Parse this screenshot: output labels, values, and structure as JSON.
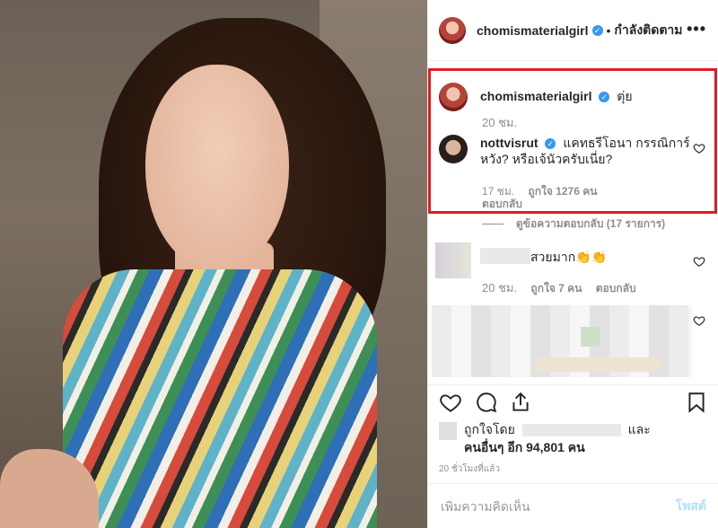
{
  "post": {
    "author": "chomismaterialgirl",
    "follow_status": "กำลังติดตาม",
    "separator": "•",
    "more": "•••"
  },
  "caption": {
    "username": "chomismaterialgirl",
    "text": "ตุ่ย",
    "time": "20 ชม."
  },
  "comments": [
    {
      "username": "nottvisrut",
      "text_line1": "แคทธรีโอนา กรรณิการ์",
      "text_line2": "หวัง? หรือเจ้นัวครับเนี่ย?",
      "time": "17 ชม.",
      "likes": "ถูกใจ 1276 คน",
      "reply": "ตอบกลับ",
      "view_replies": "ดูข้อความตอบกลับ (17 รายการ)"
    },
    {
      "text": "สวยมาก👏👏",
      "time": "20 ชม.",
      "likes": "ถูกใจ 7 คน",
      "reply": "ตอบกลับ"
    }
  ],
  "likes_section": {
    "liked_by": "ถูกใจโดย",
    "and": "และ",
    "others": "คนอื่นๆ อีก 94,801 คน",
    "time_ago": "20 ชั่วโมงที่แล้ว"
  },
  "add_comment": {
    "placeholder": "เพิ่มความคิดเห็น",
    "post_label": "โพสต์"
  },
  "colors": {
    "highlight_border": "#e21c23",
    "verified": "#3897f0",
    "post_button": "#b2dffc"
  },
  "icons": [
    "heart-icon",
    "comment-icon",
    "share-icon",
    "bookmark-icon",
    "more-icon",
    "verified-icon"
  ]
}
